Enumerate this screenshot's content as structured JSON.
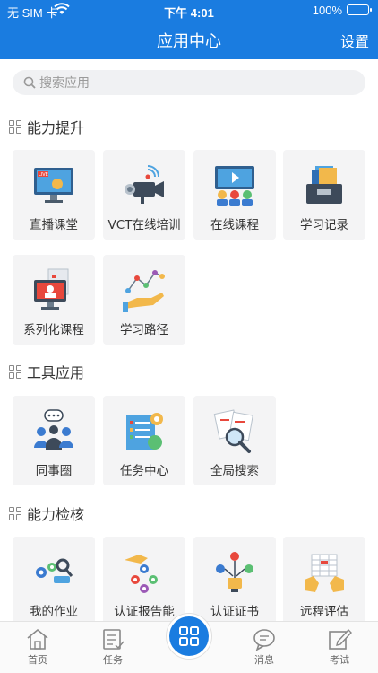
{
  "status_bar": {
    "carrier": "无 SIM 卡",
    "time": "下午 4:01",
    "battery": "100%"
  },
  "nav": {
    "title": "应用中心",
    "right_action": "设置"
  },
  "search": {
    "placeholder": "搜索应用"
  },
  "sections": [
    {
      "title": "能力提升",
      "items": [
        {
          "label": "直播课堂",
          "icon": "live-class-icon"
        },
        {
          "label": "VCT在线培训",
          "icon": "video-camera-icon"
        },
        {
          "label": "在线课程",
          "icon": "online-course-icon"
        },
        {
          "label": "学习记录",
          "icon": "study-record-icon"
        },
        {
          "label": "系列化课程",
          "icon": "series-course-icon"
        },
        {
          "label": "学习路径",
          "icon": "learning-path-icon"
        }
      ]
    },
    {
      "title": "工具应用",
      "items": [
        {
          "label": "同事圈",
          "icon": "colleague-circle-icon"
        },
        {
          "label": "任务中心",
          "icon": "task-center-icon"
        },
        {
          "label": "全局搜索",
          "icon": "global-search-icon"
        }
      ]
    },
    {
      "title": "能力检核",
      "items": [
        {
          "label": "我的作业",
          "icon": "homework-icon"
        },
        {
          "label": "认证报告能",
          "icon": "cert-report-icon"
        },
        {
          "label": "认证证书",
          "icon": "certificate-icon"
        },
        {
          "label": "远程评估",
          "icon": "remote-assessment-icon"
        }
      ]
    }
  ],
  "tabbar": {
    "home": "首页",
    "tasks": "任务",
    "messages": "消息",
    "exam": "考试"
  },
  "colors": {
    "brand": "#1a7ce0",
    "tile_bg": "#f4f4f5"
  }
}
